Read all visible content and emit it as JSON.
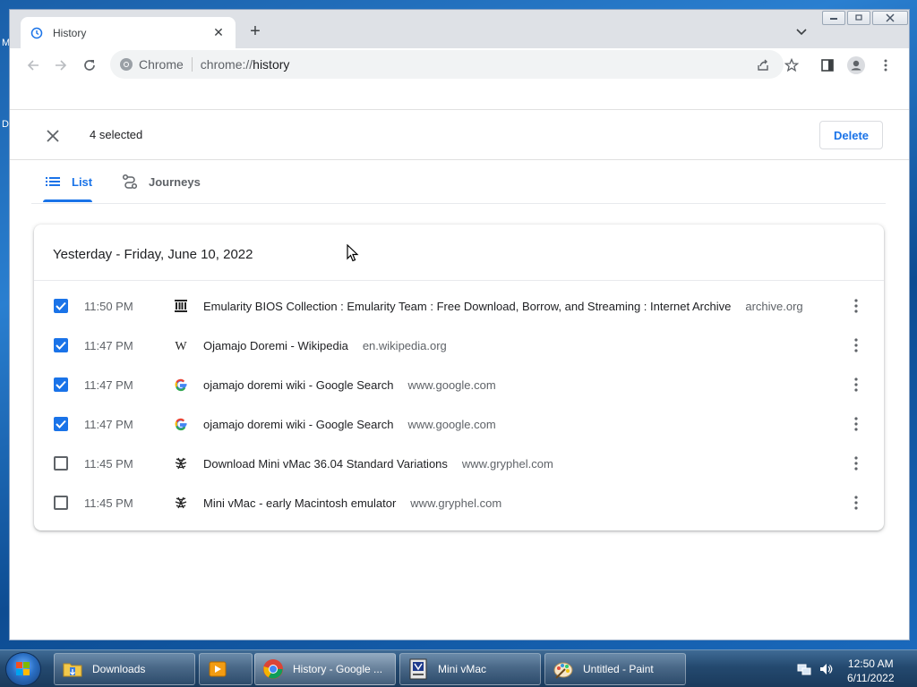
{
  "desktop": {
    "frag_left_top": "M",
    "frag_left_mid": "D"
  },
  "tab": {
    "title": "History",
    "close": "✕",
    "new_tab": "+"
  },
  "omnibox": {
    "site": "Chrome",
    "url_scheme": "chrome://",
    "url_path": "history"
  },
  "selection": {
    "count_label": "4 selected",
    "delete_label": "Delete"
  },
  "history_tabs": [
    {
      "label": "List",
      "icon": "list-icon",
      "active": true
    },
    {
      "label": "Journeys",
      "icon": "journeys-icon",
      "active": false
    }
  ],
  "card": {
    "title": "Yesterday - Friday, June 10, 2022",
    "entries": [
      {
        "time": "11:50 PM",
        "title": "Emularity BIOS Collection : Emularity Team : Free Download, Borrow, and Streaming : Internet Archive",
        "domain": "archive.org",
        "favicon": "internet-archive-favicon",
        "checked": true
      },
      {
        "time": "11:47 PM",
        "title": "Ojamajo Doremi - Wikipedia",
        "domain": "en.wikipedia.org",
        "favicon": "wikipedia-favicon",
        "checked": true
      },
      {
        "time": "11:47 PM",
        "title": "ojamajo doremi wiki - Google Search",
        "domain": "www.google.com",
        "favicon": "google-favicon",
        "checked": true
      },
      {
        "time": "11:47 PM",
        "title": "ojamajo doremi wiki - Google Search",
        "domain": "www.google.com",
        "favicon": "google-favicon",
        "checked": true
      },
      {
        "time": "11:45 PM",
        "title": "Download Mini vMac 36.04 Standard Variations",
        "domain": "www.gryphel.com",
        "favicon": "gryphel-favicon",
        "checked": false
      },
      {
        "time": "11:45 PM",
        "title": "Mini vMac - early Macintosh emulator",
        "domain": "www.gryphel.com",
        "favicon": "gryphel-favicon",
        "checked": false
      }
    ]
  },
  "taskbar": {
    "buttons": [
      {
        "label": "Downloads",
        "icon": "folder-icon"
      },
      {
        "label": "",
        "icon": "media-player-icon"
      },
      {
        "label": "History - Google ...",
        "icon": "chrome-icon"
      },
      {
        "label": "Mini vMac",
        "icon": "mini-vmac-icon"
      },
      {
        "label": "Untitled - Paint",
        "icon": "paint-icon"
      }
    ],
    "clock_time": "12:50 AM",
    "clock_date": "6/11/2022"
  },
  "colors": {
    "accent": "#1a73e8",
    "text_primary": "#202124",
    "text_secondary": "#5f6368"
  }
}
